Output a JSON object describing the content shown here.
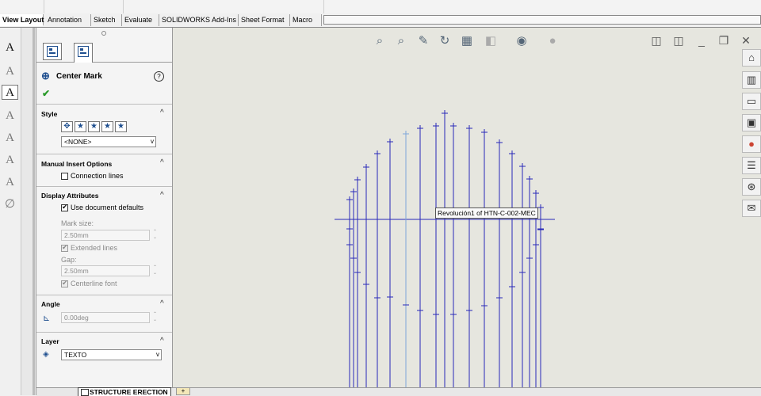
{
  "tabs": [
    "View Layout",
    "Annotation",
    "Sketch",
    "Evaluate",
    "SOLIDWORKS Add-Ins",
    "Sheet Format",
    "Macro"
  ],
  "panel": {
    "title": "Center Mark",
    "help_icon": "?",
    "style": {
      "header": "Style",
      "dropdown": "<NONE>"
    },
    "manual": {
      "header": "Manual Insert Options",
      "connection_lines": "Connection lines"
    },
    "display": {
      "header": "Display Attributes",
      "use_doc_defaults": "Use document defaults",
      "mark_size_label": "Mark size:",
      "mark_size_value": "2.50mm",
      "extended_lines": "Extended lines",
      "gap_label": "Gap:",
      "gap_value": "2.50mm",
      "centerline_font": "Centerline font"
    },
    "angle": {
      "header": "Angle",
      "value": "0.00deg"
    },
    "layer": {
      "header": "Layer",
      "value": "TEXTO"
    }
  },
  "canvas": {
    "tooltip": "Revolución1 of HTN-C-002-MEC"
  },
  "sheet_tab": "STRUCTURE ERECTION",
  "drawing": {
    "line_color": "#2828b8",
    "highlight_color": "#7ea6d8",
    "background": "#e6e6df"
  }
}
